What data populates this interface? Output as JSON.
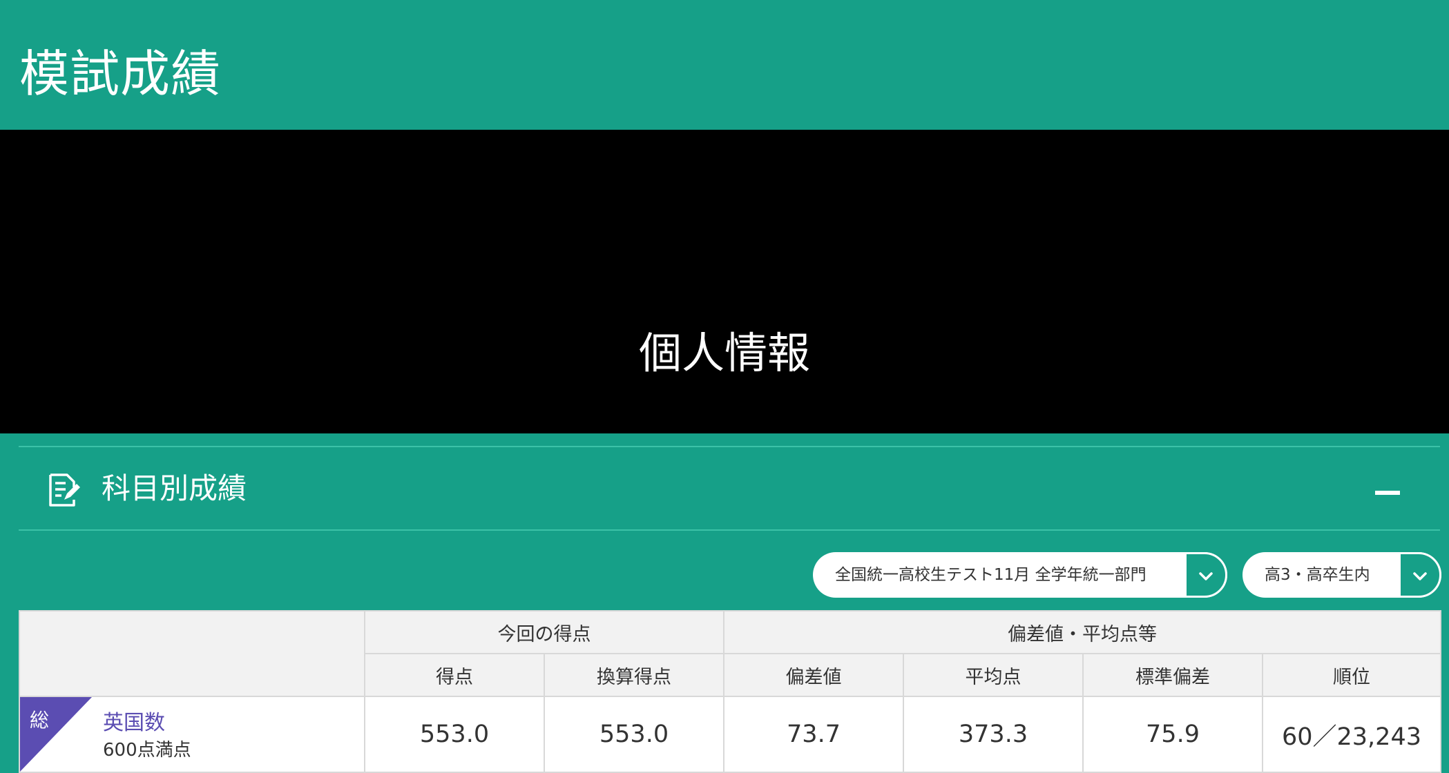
{
  "page": {
    "title": "模試成績"
  },
  "personal": {
    "label": "個人情報"
  },
  "section": {
    "title": "科目別成績",
    "icon": "document-edit-icon",
    "collapse_icon": "minus-icon"
  },
  "filters": {
    "exam": "全国統一高校生テスト11月 全学年統一部門",
    "group": "高3・高卒生内"
  },
  "table": {
    "group_headers": [
      "今回の得点",
      "偏差値・平均点等"
    ],
    "columns": [
      "得点",
      "換算得点",
      "偏差値",
      "平均点",
      "標準偏差",
      "順位"
    ],
    "rows": [
      {
        "tag": "総",
        "subject": "英国数",
        "max_score": "600点満点",
        "score": "553.0",
        "converted_score": "553.0",
        "deviation": "73.7",
        "average": "373.3",
        "std_dev": "75.9",
        "rank": "60／23,243"
      }
    ]
  },
  "colors": {
    "brand_green": "#16a088",
    "tag_purple": "#5b4db2",
    "link_purple": "#5b4db2"
  }
}
